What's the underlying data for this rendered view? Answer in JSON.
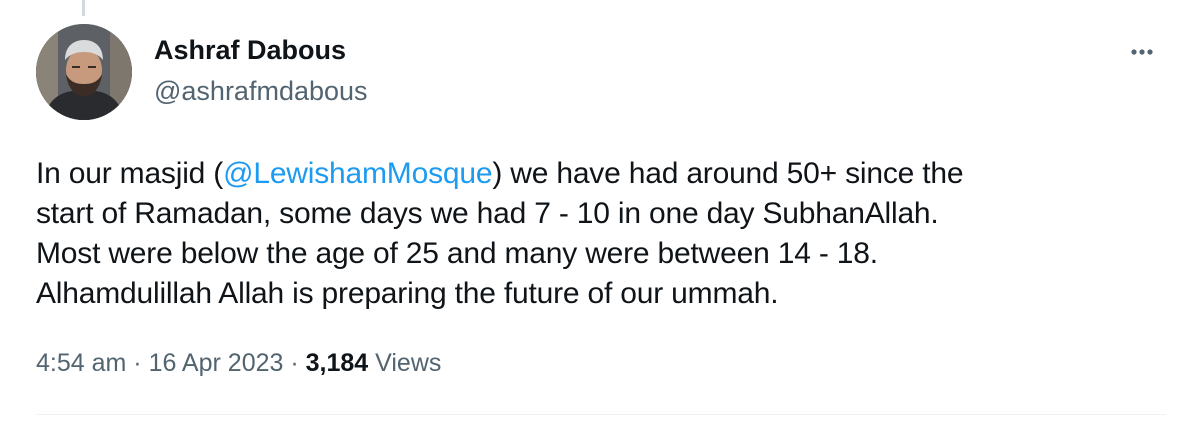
{
  "tweet": {
    "author": {
      "display_name": "Ashraf Dabous",
      "handle": "@ashrafmdabous"
    },
    "text": {
      "line1_before": "In our masjid (",
      "mention": "@LewishamMosque",
      "line1_after": ") we have had around 50+ since the",
      "line2": "start of Ramadan, some days we had 7 - 10 in one day SubhanAllah.",
      "line3": "Most were below the age of 25 and many were between 14 - 18.",
      "line4": "Alhamdulillah Allah is preparing the future of our ummah."
    },
    "meta": {
      "time": "4:54 am",
      "separator": " · ",
      "date": "16 Apr 2023",
      "views_count": "3,184",
      "views_label": " Views"
    }
  },
  "icons": {
    "more": "more-horizontal-icon",
    "avatar": "profile-photo"
  },
  "colors": {
    "text": "#0f1419",
    "secondary": "#536471",
    "link": "#1d9bf0",
    "divider": "#eff3f4"
  }
}
